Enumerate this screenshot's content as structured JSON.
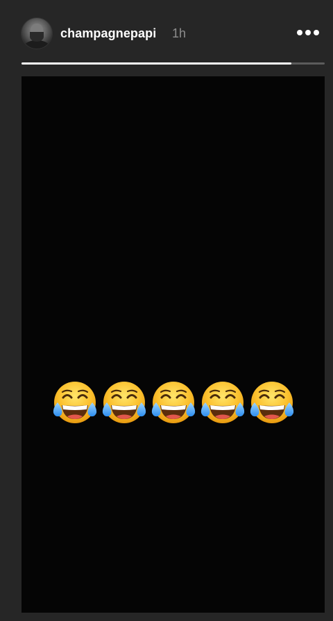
{
  "story": {
    "username": "champagnepapi",
    "timestamp": "1h",
    "progress": 0.89,
    "more_icon": "ellipsis-horizontal-icon",
    "avatar_icon": "profile-avatar",
    "content": {
      "emoji_name": "face-with-tears-of-joy",
      "emoji_count": 5
    }
  },
  "colors": {
    "background": "#262626",
    "story_bg": "#050505",
    "progress_track": "#5c5c5c",
    "progress_fill": "#ffffff",
    "username": "#ffffff",
    "timestamp": "#8e8e8e"
  }
}
